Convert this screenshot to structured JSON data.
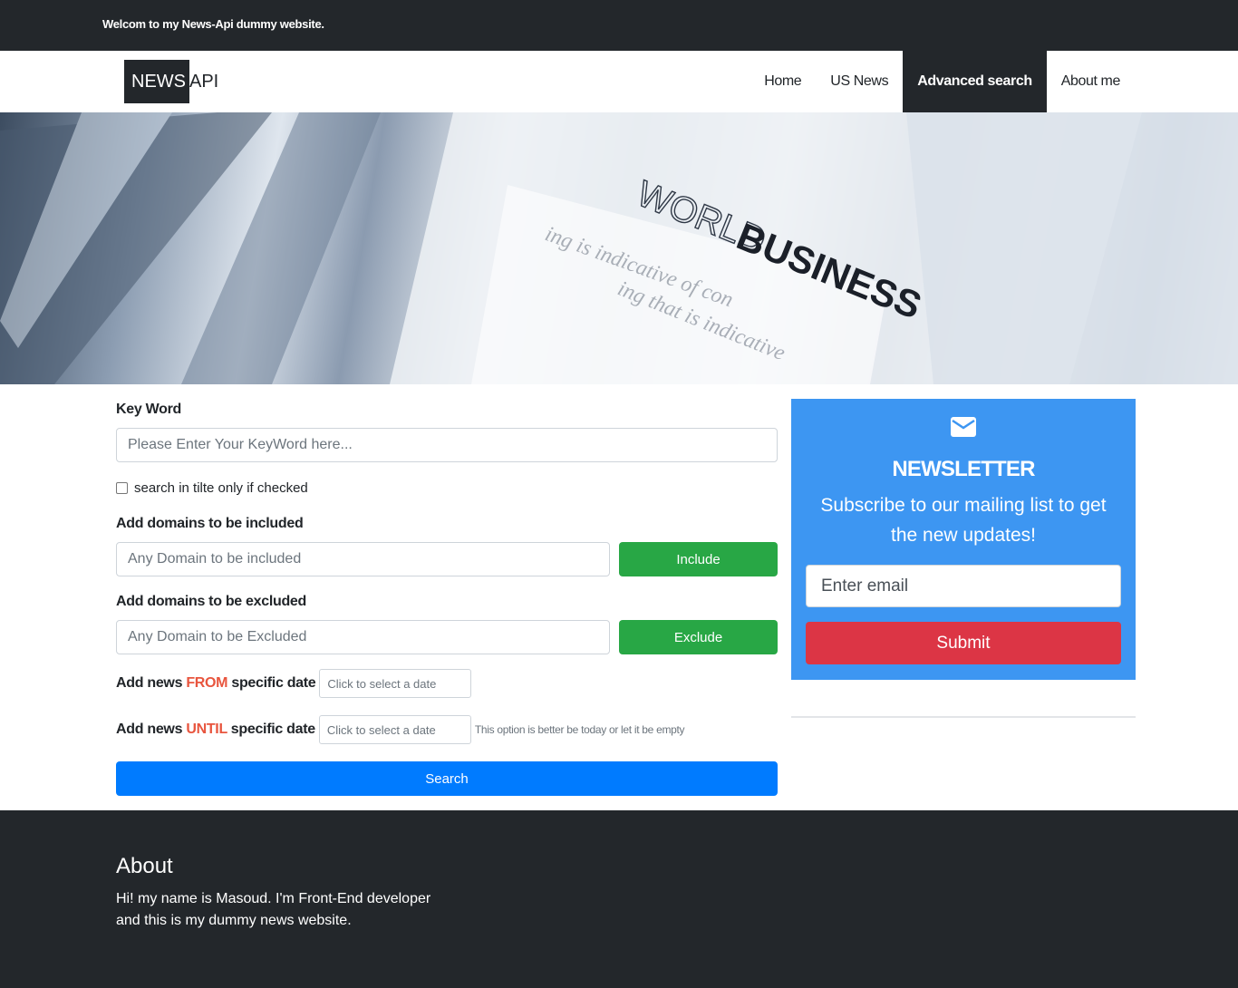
{
  "topbar": {
    "text": "Welcom to my News-Api dummy website."
  },
  "brand": {
    "part1": "NEWS",
    "part2": "API"
  },
  "nav": [
    {
      "label": "Home",
      "active": false
    },
    {
      "label": "US News",
      "active": false
    },
    {
      "label": "Advanced search",
      "active": true
    },
    {
      "label": "About me",
      "active": false
    }
  ],
  "hero": {
    "line1": "WORLD",
    "line2": "BUSINESS"
  },
  "form": {
    "keyword_label": "Key Word",
    "keyword_placeholder": "Please Enter Your KeyWord here...",
    "title_only_label": "search in tilte only if checked",
    "title_only_checked": false,
    "include_label": "Add domains to be included",
    "include_placeholder": "Any Domain to be included",
    "include_button": "Include",
    "exclude_label": "Add domains to be excluded",
    "exclude_placeholder": "Any Domain to be Excluded",
    "exclude_button": "Exclude",
    "from_prefix": "Add news ",
    "from_keyword": "FROM",
    "from_suffix": " specific date",
    "from_placeholder": "Click to select a date",
    "until_prefix": "Add news ",
    "until_keyword": "UNTIL",
    "until_suffix": " specific date",
    "until_placeholder": "Click to select a date",
    "until_hint": "This option is better be today or let it be empty",
    "search_button": "Search"
  },
  "newsletter": {
    "icon": "envelope-icon",
    "title": "NEWSLETTER",
    "subtitle": "Subscribe to our mailing list to get the new updates!",
    "email_placeholder": "Enter email",
    "submit_label": "Submit"
  },
  "footer": {
    "title": "About",
    "text": "Hi! my name is Masoud. I'm Front-End developer and this is my dummy news website."
  },
  "colors": {
    "dark": "#23272b",
    "green": "#28a745",
    "blue": "#007bff",
    "newsletter_bg": "#3d96f2",
    "red": "#dc3545",
    "accent_text": "#e8553e"
  }
}
